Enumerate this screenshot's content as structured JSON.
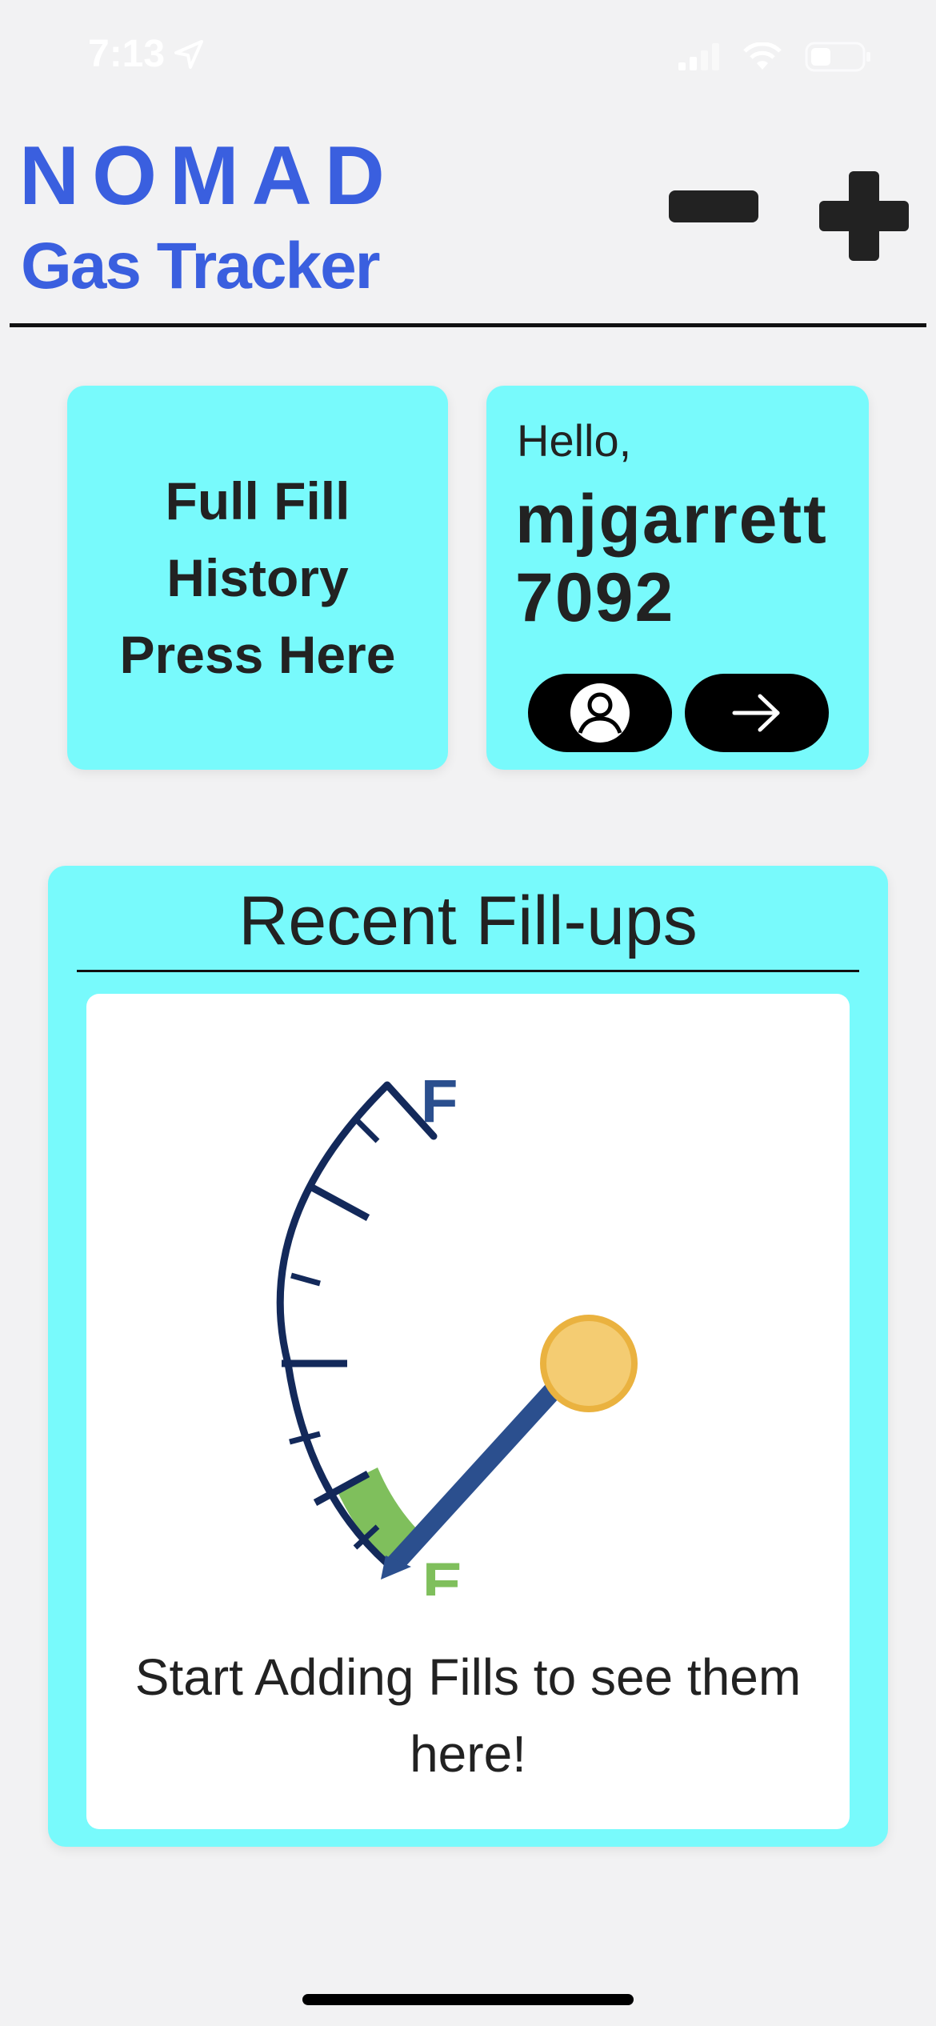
{
  "status_bar": {
    "time": "7:13",
    "icons": [
      "location-arrow-icon",
      "cellular-signal-icon",
      "wifi-icon",
      "battery-icon"
    ]
  },
  "header": {
    "brand": "NOMAD",
    "subtitle": "Gas Tracker",
    "brand_color": "#3a5fdf"
  },
  "history_card": {
    "label": "Full Fill History Press Here"
  },
  "hello_card": {
    "greeting": "Hello,",
    "username": "mjgarrett 7092"
  },
  "recent": {
    "title": "Recent Fill-ups",
    "gauge_full_label": "F",
    "gauge_empty_label": "E",
    "empty_message": "Start Adding Fills to see them here!"
  },
  "colors": {
    "card_background": "#78fafc",
    "page_background": "#f2f2f3",
    "gauge_navy": "#13295a",
    "gauge_green": "#7fbf5c",
    "needle_blue": "#2b4f8e",
    "needle_cap": "#f4cc72"
  }
}
